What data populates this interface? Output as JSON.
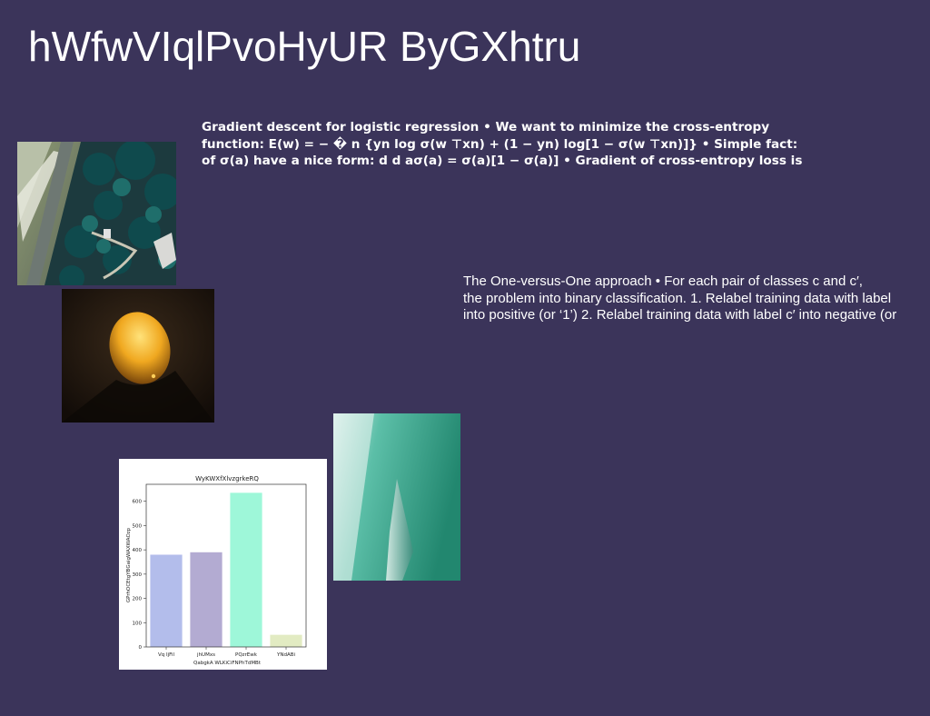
{
  "page": {
    "title": "hWfwVIqlPvoHyUR ByGXhtru",
    "background": "#3b345a"
  },
  "text_blocks": {
    "logistic": {
      "lines": [
        "Gradient descent for logistic regression • We want to minimize the cross-entropy",
        "function: E(w) = − � n {yn log σ(w ⊤xn) + (1 − yn) log[1 − σ(w ⊤xn)]} • Simple fact:",
        "of σ(a) have a nice form: d d aσ(a) = σ(a)[1 − σ(a)] • Gradient of cross-entropy loss is"
      ]
    },
    "ovo": {
      "lines": [
        "The One-versus-One approach • For each pair of classes c and c′,",
        "the problem into binary classification. 1. Relabel training data with label",
        "into positive (or ‘1’) 2. Relabel training data with label c′ into negative (or"
      ]
    }
  },
  "images": [
    {
      "name": "aerial-coastline-photo"
    },
    {
      "name": "glowing-moon-photo"
    },
    {
      "name": "teal-abstract-photo"
    }
  ],
  "chart_data": {
    "type": "bar",
    "title": "WyKWXfXlvzgrkeRQ",
    "xlabel": "QabgkA WLKiCiFNPhTdMBt",
    "ylabel": "GPrhOCEtgYBGaigWAXWAOzp",
    "categories": [
      "Vq IjFil",
      "jhUMxs",
      "PQzrEwk",
      "YNdABi"
    ],
    "values": [
      380,
      390,
      635,
      50
    ],
    "colors": [
      "#b3bdeb",
      "#b3abd2",
      "#9ef7d9",
      "#e2ebc2"
    ],
    "ylim": [
      0,
      670
    ],
    "yticks": [
      0,
      100,
      200,
      300,
      400,
      500,
      600
    ],
    "grid": false
  }
}
